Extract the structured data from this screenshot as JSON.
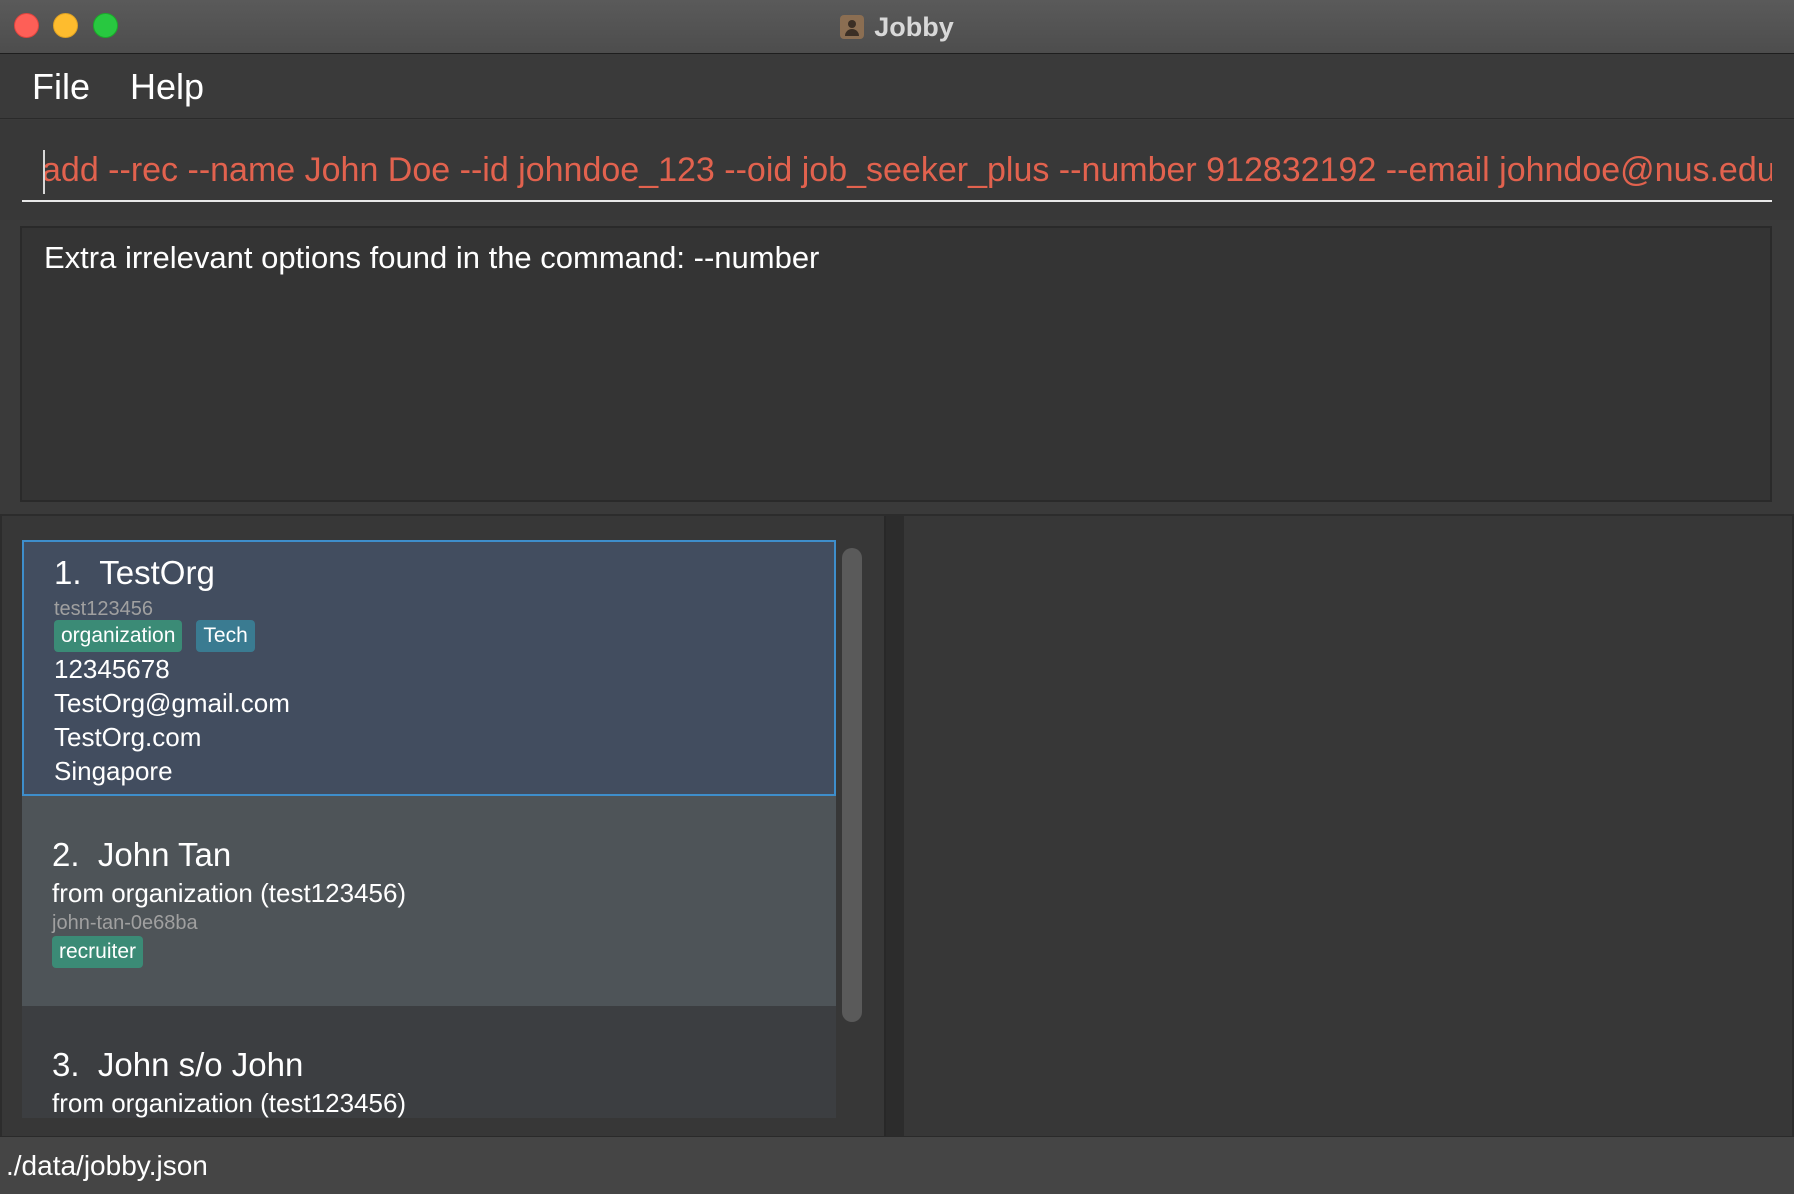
{
  "window": {
    "title": "Jobby",
    "app_icon": "contacts-icon"
  },
  "menu": {
    "file": "File",
    "help": "Help"
  },
  "command": {
    "value": "add --rec --name John Doe --id johndoe_123 --oid job_seeker_plus --number 912832192 --email johndoe@nus.edu",
    "text_color": "#e2624e"
  },
  "result": {
    "message": "Extra irrelevant options found in the command: --number"
  },
  "contacts": [
    {
      "index": "1.",
      "name": "TestOrg",
      "id": "test123456",
      "tags": [
        "organization",
        "Tech"
      ],
      "phone": "12345678",
      "email": "TestOrg@gmail.com",
      "url": "TestOrg.com",
      "address": "Singapore"
    },
    {
      "index": "2.",
      "name": "John Tan",
      "from": "from organization (test123456)",
      "id": "john-tan-0e68ba",
      "tags": [
        "recruiter"
      ]
    },
    {
      "index": "3.",
      "name": "John s/o John",
      "from": "from organization (test123456)"
    }
  ],
  "status": {
    "file_path": "./data/jobby.json"
  },
  "colors": {
    "tag_green": "#3b8b76",
    "tag_blue": "#3a7b91",
    "selected_border": "#3e8ecb",
    "error_text": "#e2624e"
  }
}
